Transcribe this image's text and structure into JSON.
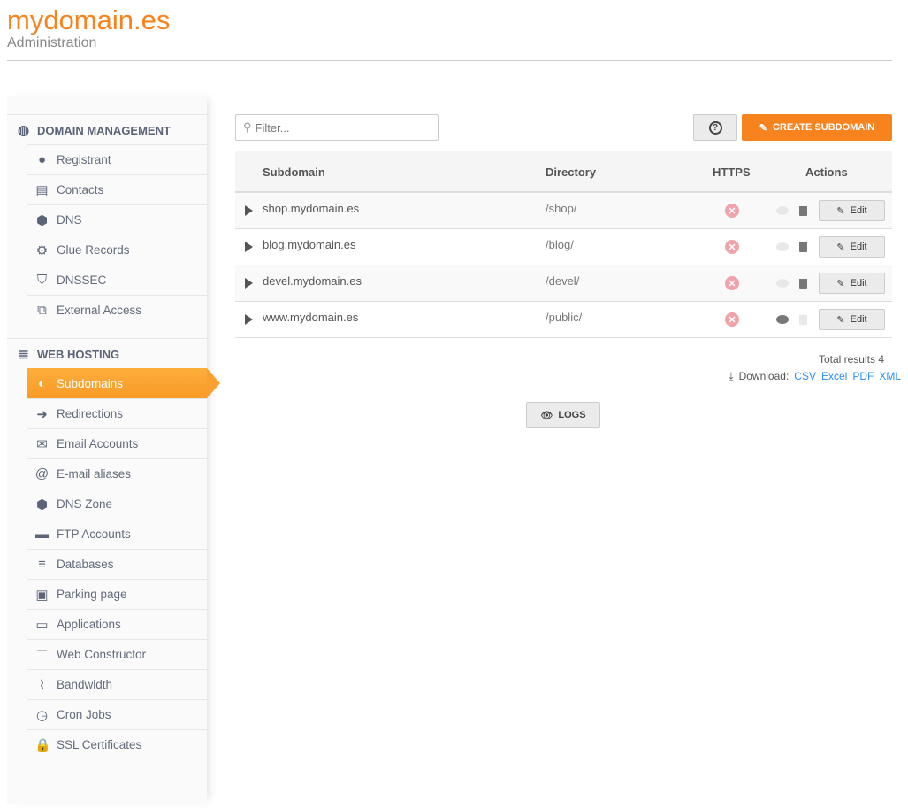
{
  "header": {
    "brand": "mydomain.es",
    "subtitle": "Administration"
  },
  "sidebar": {
    "sections": [
      {
        "label": "DOMAIN MANAGEMENT",
        "icon": "globe-icon",
        "items": [
          {
            "label": "Registrant",
            "icon": "user-icon"
          },
          {
            "label": "Contacts",
            "icon": "contacts-icon"
          },
          {
            "label": "DNS",
            "icon": "badge-icon"
          },
          {
            "label": "Glue Records",
            "icon": "gear-icon"
          },
          {
            "label": "DNSSEC",
            "icon": "shield-icon"
          },
          {
            "label": "External Access",
            "icon": "external-link-icon"
          }
        ]
      },
      {
        "label": "WEB HOSTING",
        "icon": "server-icon",
        "items": [
          {
            "label": "Subdomains",
            "icon": "half-circle-icon",
            "active": true
          },
          {
            "label": "Redirections",
            "icon": "arrow-circle-icon"
          },
          {
            "label": "Email Accounts",
            "icon": "envelope-icon"
          },
          {
            "label": "E-mail aliases",
            "icon": "at-icon"
          },
          {
            "label": "DNS Zone",
            "icon": "badge-icon"
          },
          {
            "label": "FTP Accounts",
            "icon": "folder-icon"
          },
          {
            "label": "Databases",
            "icon": "database-icon"
          },
          {
            "label": "Parking page",
            "icon": "page-icon"
          },
          {
            "label": "Applications",
            "icon": "monitor-icon"
          },
          {
            "label": "Web Constructor",
            "icon": "hammer-icon"
          },
          {
            "label": "Bandwidth",
            "icon": "bandwidth-icon"
          },
          {
            "label": "Cron Jobs",
            "icon": "clock-icon"
          },
          {
            "label": "SSL Certificates",
            "icon": "lock-icon"
          }
        ]
      }
    ]
  },
  "toolbar": {
    "filter_placeholder": "Filter...",
    "help": "?",
    "create_label": "CREATE SUBDOMAIN"
  },
  "table": {
    "headers": [
      "Subdomain",
      "Directory",
      "HTTPS",
      "Actions"
    ],
    "rows": [
      {
        "subdomain": "shop.mydomain.es",
        "directory": "/shop/",
        "https": false,
        "edit": "Edit"
      },
      {
        "subdomain": "blog.mydomain.es",
        "directory": "/blog/",
        "https": false,
        "edit": "Edit"
      },
      {
        "subdomain": "devel.mydomain.es",
        "directory": "/devel/",
        "https": false,
        "edit": "Edit"
      },
      {
        "subdomain": "www.mydomain.es",
        "directory": "/public/",
        "https": false,
        "edit": "Edit"
      }
    ]
  },
  "footer": {
    "total": "Total results 4",
    "download_label": "Download:",
    "formats": [
      "CSV",
      "Excel",
      "PDF",
      "XML"
    ],
    "logs_label": "LOGS"
  },
  "colors": {
    "brand": "#f7831f",
    "link": "#2b8ff0",
    "https_off": "#f0a3a8"
  }
}
